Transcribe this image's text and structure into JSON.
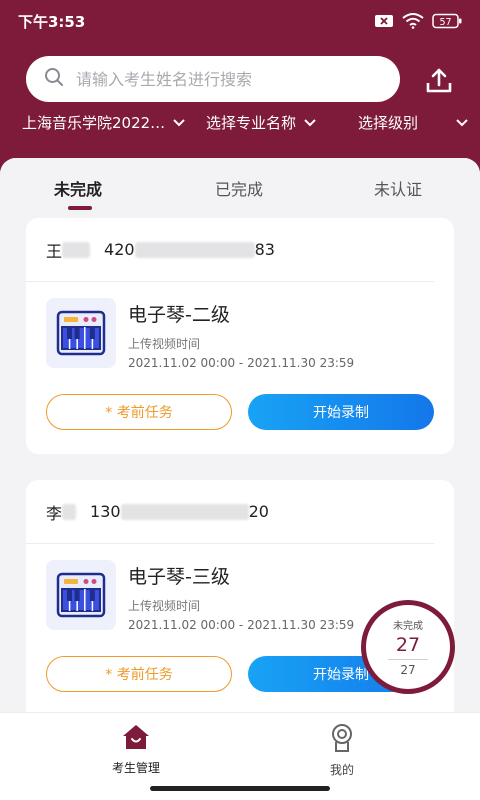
{
  "status": {
    "time": "下午3:53",
    "battery": "57"
  },
  "search": {
    "placeholder": "请输入考生姓名进行搜索"
  },
  "filters": {
    "school": "上海音乐学院2022…",
    "major": "选择专业名称",
    "level": "选择级别"
  },
  "tabs": {
    "incomplete": "未完成",
    "complete": "已完成",
    "unverified": "未认证"
  },
  "cards": [
    {
      "name_prefix": "王",
      "id_prefix": "420",
      "id_suffix": "83",
      "exam_title": "电子琴-二级",
      "upload_label": "上传视频时间",
      "time_range": "2021.11.02 00:00 - 2021.11.30 23:59",
      "task_button": "* 考前任务",
      "record_button": "开始录制"
    },
    {
      "name_prefix": "李",
      "id_prefix": "130",
      "id_suffix": "20",
      "exam_title": "电子琴-三级",
      "upload_label": "上传视频时间",
      "time_range": "2021.11.02 00:00 - 2021.11.30 23:59",
      "task_button": "* 考前任务",
      "record_button": "开始录制"
    }
  ],
  "counter": {
    "label": "未完成",
    "value": "27",
    "total": "27"
  },
  "nav": {
    "home": "考生管理",
    "me": "我的"
  },
  "colors": {
    "brand": "#7e1a3a",
    "accent_orange": "#ef9a2a",
    "accent_blue": "#1477ea"
  }
}
